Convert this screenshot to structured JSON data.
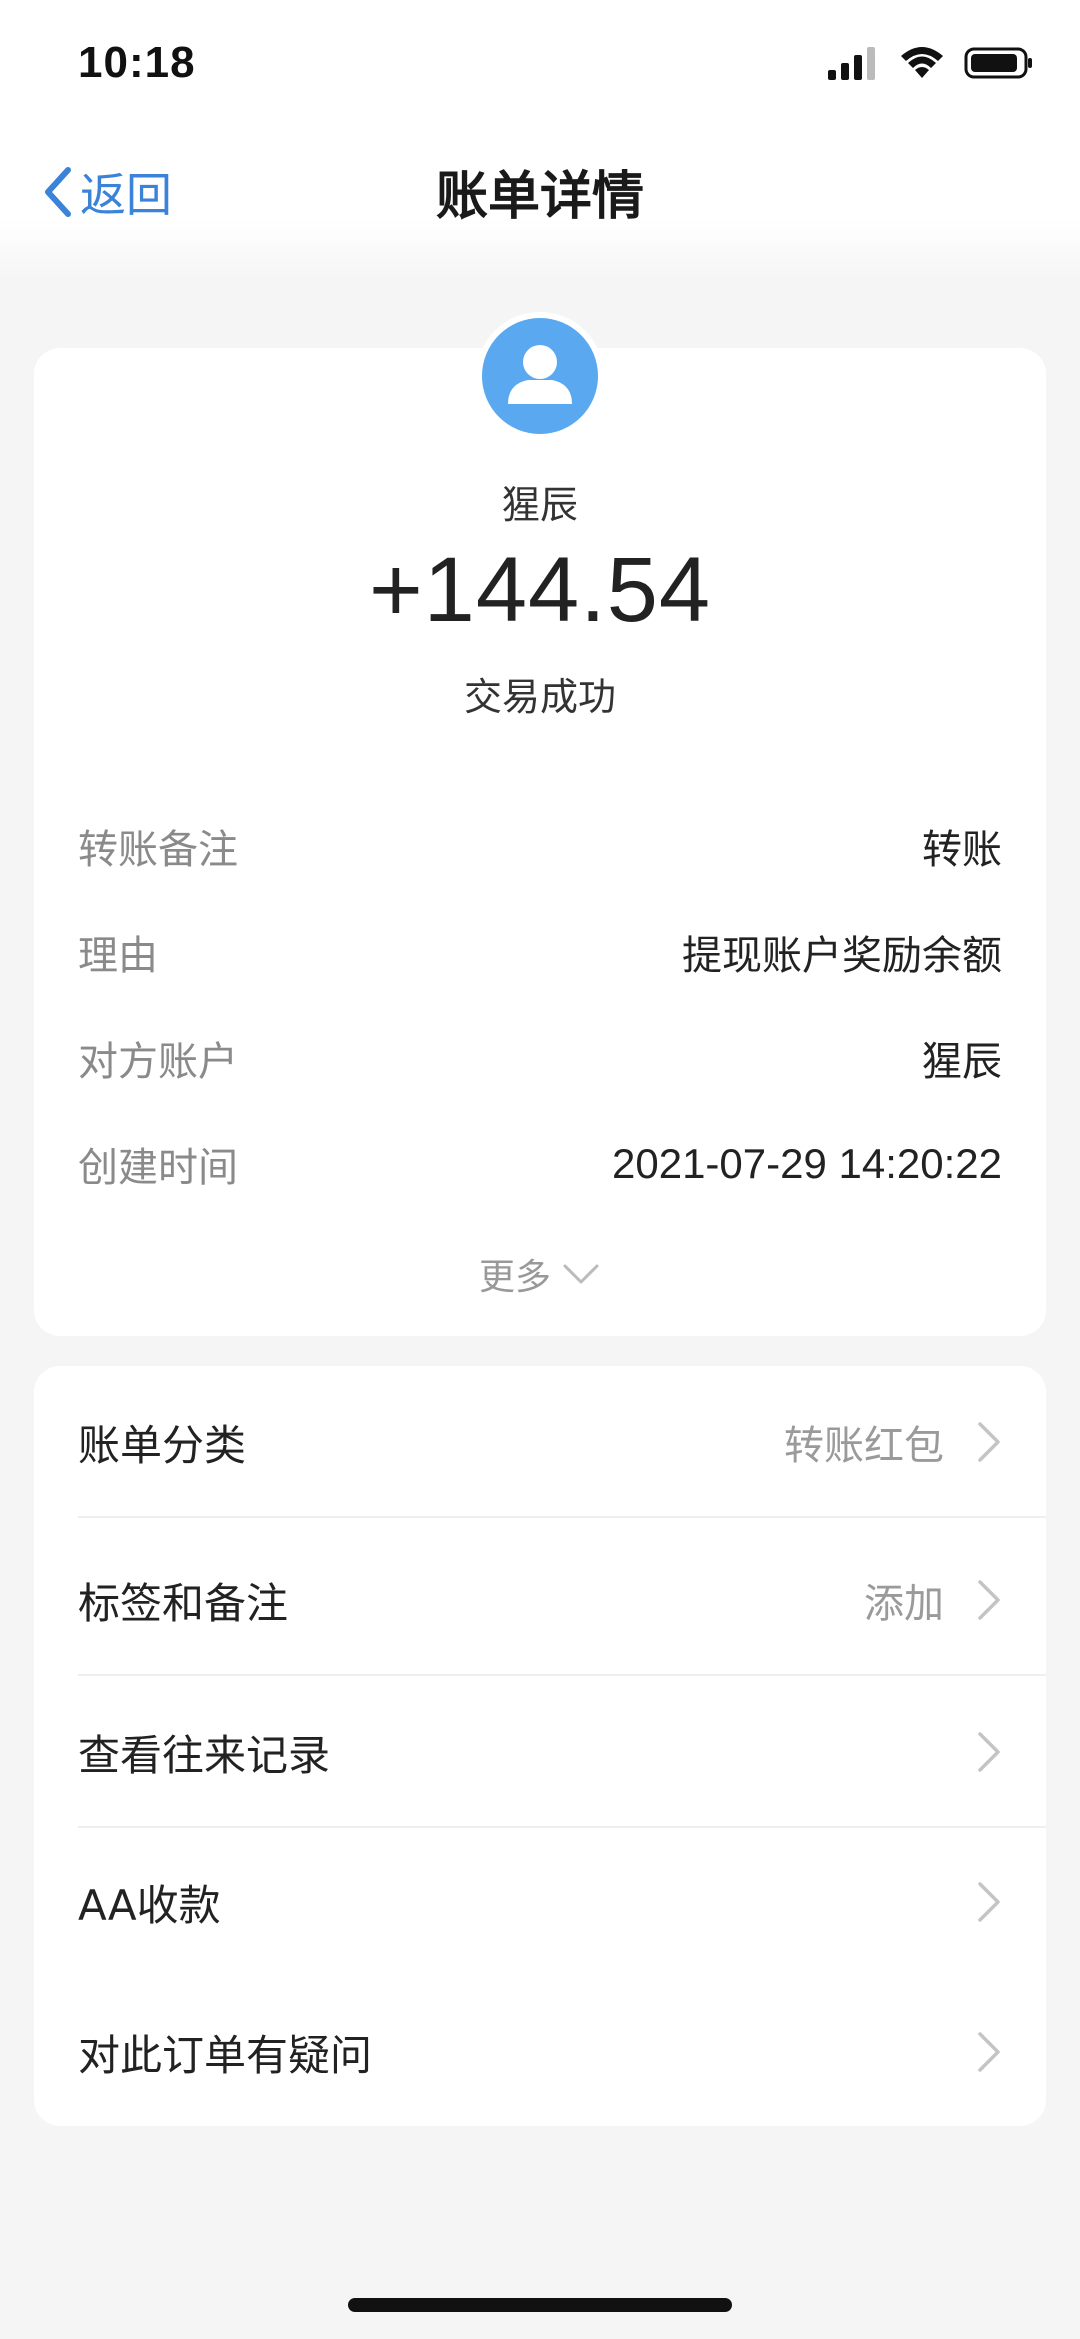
{
  "status_bar": {
    "time": "10:18"
  },
  "nav": {
    "back_label": "返回",
    "title": "账单详情"
  },
  "summary": {
    "payee": "猩辰",
    "amount": "+144.54",
    "status": "交易成功",
    "details": [
      {
        "label": "转账备注",
        "value": "转账"
      },
      {
        "label": "理由",
        "value": "提现账户奖励余额"
      },
      {
        "label": "对方账户",
        "value": "猩辰"
      },
      {
        "label": "创建时间",
        "value": "2021-07-29 14:20:22"
      }
    ],
    "more_label": "更多"
  },
  "actions": [
    {
      "label": "账单分类",
      "value": "转账红包"
    },
    {
      "label": "标签和备注",
      "value": "添加"
    },
    {
      "label": "查看往来记录",
      "value": ""
    },
    {
      "label": "AA收款",
      "value": ""
    },
    {
      "label": "对此订单有疑问",
      "value": ""
    }
  ],
  "colors": {
    "accent": "#3b82d9",
    "avatar": "#5aa9f0",
    "background": "#f5f5f5"
  }
}
